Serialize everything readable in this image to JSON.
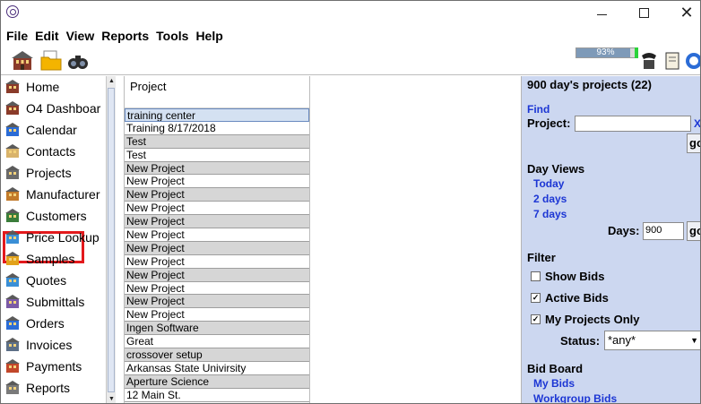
{
  "menus": [
    "File",
    "Edit",
    "View",
    "Reports",
    "Tools",
    "Help"
  ],
  "progress": {
    "percent_label": "93%",
    "value": 0.93
  },
  "sidebar": {
    "items": [
      {
        "label": "Home",
        "icon": "house-icon"
      },
      {
        "label": "O4 Dashboar",
        "icon": "dashboard-icon"
      },
      {
        "label": "Calendar",
        "icon": "calendar-icon"
      },
      {
        "label": "Contacts",
        "icon": "contacts-icon"
      },
      {
        "label": "Projects",
        "icon": "building-icon"
      },
      {
        "label": "Manufacturer",
        "icon": "manufacturer-icon"
      },
      {
        "label": "Customers",
        "icon": "customers-icon"
      },
      {
        "label": "Price Lookup",
        "icon": "price-lookup-icon"
      },
      {
        "label": "Samples",
        "icon": "samples-icon"
      },
      {
        "label": "Quotes",
        "icon": "quotes-icon"
      },
      {
        "label": "Submittals",
        "icon": "submittals-icon"
      },
      {
        "label": "Orders",
        "icon": "orders-icon"
      },
      {
        "label": "Invoices",
        "icon": "invoices-icon"
      },
      {
        "label": "Payments",
        "icon": "payments-icon"
      },
      {
        "label": "Reports",
        "icon": "reports-icon"
      }
    ],
    "selected": "Projects"
  },
  "projects": {
    "header": "Project",
    "rows": [
      "training center",
      "Training 8/17/2018",
      "Test",
      "Test",
      "New Project",
      "New Project",
      "New Project",
      "New Project",
      "New Project",
      "New Project",
      "New Project",
      "New Project",
      "New Project",
      "New Project",
      "New Project",
      "New Project",
      "Ingen Software",
      "Great",
      "crossover setup",
      "Arkansas State Univirsity",
      "Aperture Science",
      "12 Main St."
    ]
  },
  "panel": {
    "title": "900 day's projects (22)",
    "find_link": "Find",
    "project_label": "Project:",
    "project_value": "",
    "clear_link": "X",
    "go_label": "go",
    "day_views_title": "Day Views",
    "day_links": [
      "Today",
      "2 days",
      "7 days"
    ],
    "days_label": "Days:",
    "days_value": "900",
    "filter_title": "Filter",
    "show_bids": {
      "label": "Show Bids",
      "checked": false
    },
    "active_bids": {
      "label": "Active Bids",
      "checked": true
    },
    "my_projects": {
      "label": "My Projects Only",
      "checked": true
    },
    "status_label": "Status:",
    "status_value": "*any*",
    "bid_board_title": "Bid Board",
    "bid_links": [
      "My Bids",
      "Workgroup Bids"
    ]
  },
  "colors": {
    "panel_bg": "#ccd7f0",
    "link": "#1c36d4",
    "highlight": "#e3191c"
  }
}
